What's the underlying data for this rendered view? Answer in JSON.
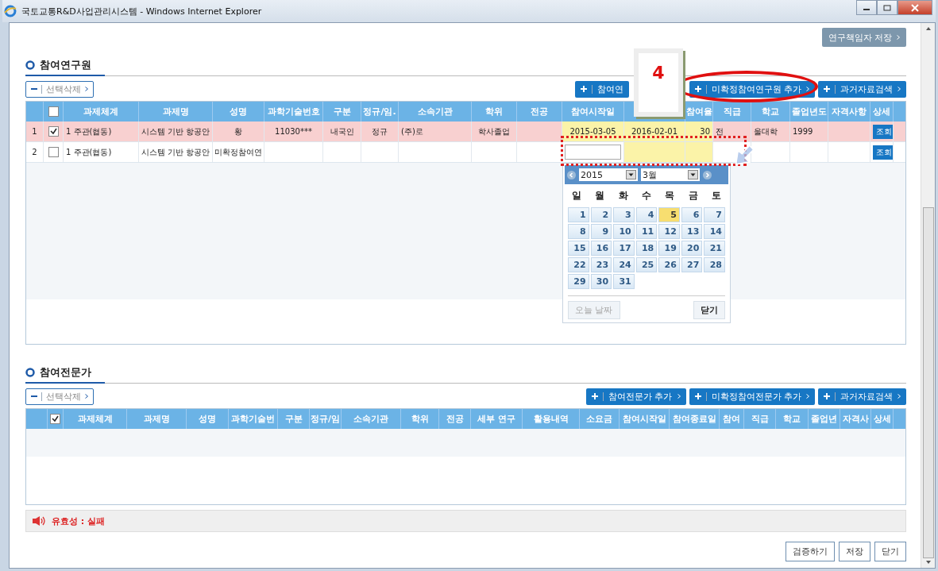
{
  "window": {
    "title": "국토교통R&D사업관리시스템 - Windows Internet Explorer"
  },
  "top_button": "연구책임자 저장",
  "researchers": {
    "title": "참여연구원",
    "delete_button": "선택삭제",
    "buttons": [
      "참여연",
      "미확정참여연구원 추가",
      "과거자료검색"
    ],
    "header_checked": false,
    "columns": [
      {
        "label": "과제체계"
      },
      {
        "label": "과제명"
      },
      {
        "label": "성명"
      },
      {
        "label": "과학기술번호"
      },
      {
        "label": "구분"
      },
      {
        "label": "정규/임."
      },
      {
        "label": "소속기관"
      },
      {
        "label": "학위"
      },
      {
        "label": "전공"
      },
      {
        "label": "참여시작일"
      },
      {},
      {
        "label": "참여율"
      },
      {
        "label": "직급"
      },
      {
        "label": "학교"
      },
      {
        "label": "졸업년도"
      },
      {
        "label": "자격사항"
      },
      {
        "label": "상세"
      }
    ],
    "rows": [
      {
        "number": "1",
        "checked": true,
        "selected": true,
        "cells": [
          {
            "text": "1 주관(협동)"
          },
          {
            "text": "시스템 기반 항공안"
          },
          {
            "text": "황"
          },
          {
            "text": "11030***"
          },
          {
            "text": "내국인"
          },
          {
            "text": "정규"
          },
          {
            "text": "(주)로"
          },
          {
            "text": "학사졸업"
          },
          {},
          {
            "text": "2015-03-05",
            "kind": "date"
          },
          {
            "text": "2016-02-01",
            "kind": "date"
          },
          {
            "text": "30",
            "kind": "date"
          },
          {
            "text": "전"
          },
          {
            "text": "울대학"
          },
          {
            "text": "1999"
          },
          {},
          {
            "text": "조회",
            "kind": "button"
          }
        ]
      },
      {
        "number": "2",
        "checked": false,
        "selected": false,
        "cells": [
          {
            "text": "1 주관(협동)"
          },
          {
            "text": "시스템 기반 항공안"
          },
          {
            "text": "미확정참여연"
          },
          {},
          {},
          {},
          {},
          {},
          {},
          {
            "kind": "input"
          },
          {
            "kind": "date"
          },
          {
            "kind": "date"
          },
          {},
          {},
          {},
          {},
          {
            "text": "조회",
            "kind": "button"
          }
        ]
      }
    ]
  },
  "calendar": {
    "year": "2015",
    "month": "3월",
    "weekdays": [
      "일",
      "월",
      "화",
      "수",
      "목",
      "금",
      "토"
    ],
    "days": [
      {
        "text": "1",
        "selected": false
      },
      {
        "text": "2",
        "selected": false
      },
      {
        "text": "3",
        "selected": false
      },
      {
        "text": "4",
        "selected": false
      },
      {
        "text": "5",
        "selected": true
      },
      {
        "text": "6",
        "selected": false
      },
      {
        "text": "7",
        "selected": false
      },
      {
        "text": "8",
        "selected": false
      },
      {
        "text": "9",
        "selected": false
      },
      {
        "text": "10",
        "selected": false
      },
      {
        "text": "11",
        "selected": false
      },
      {
        "text": "12",
        "selected": false
      },
      {
        "text": "13",
        "selected": false
      },
      {
        "text": "14",
        "selected": false
      },
      {
        "text": "15",
        "selected": false
      },
      {
        "text": "16",
        "selected": false
      },
      {
        "text": "17",
        "selected": false
      },
      {
        "text": "18",
        "selected": false
      },
      {
        "text": "19",
        "selected": false
      },
      {
        "text": "20",
        "selected": false
      },
      {
        "text": "21",
        "selected": false
      },
      {
        "text": "22",
        "selected": false
      },
      {
        "text": "23",
        "selected": false
      },
      {
        "text": "24",
        "selected": false
      },
      {
        "text": "25",
        "selected": false
      },
      {
        "text": "26",
        "selected": false
      },
      {
        "text": "27",
        "selected": false
      },
      {
        "text": "28",
        "selected": false
      },
      {
        "text": "29",
        "selected": false
      },
      {
        "text": "30",
        "selected": false
      },
      {
        "text": "31",
        "selected": false
      }
    ],
    "today_button": {
      "label": "오늘 날짜",
      "disabled": true
    },
    "close_button": "닫기"
  },
  "callout": "4",
  "experts": {
    "title": "참여전문가",
    "delete_button": "선택삭제",
    "buttons": [
      "참여전문가 추가",
      "미확정참여전문가 추가",
      "과거자료검색"
    ],
    "header_checked": true,
    "columns": [
      {
        "label": "과제체계"
      },
      {
        "label": "과제명"
      },
      {
        "label": "성명"
      },
      {
        "label": "과학기술번"
      },
      {
        "label": "구분"
      },
      {
        "label": "정규/임"
      },
      {
        "label": "소속기관"
      },
      {
        "label": "학위"
      },
      {
        "label": "전공"
      },
      {
        "label": "세부 연구"
      },
      {
        "label": "활용내역"
      },
      {
        "label": "소요금"
      },
      {
        "label": "참여시작일"
      },
      {
        "label": "참여종료일"
      },
      {
        "label": "참여"
      },
      {
        "label": "직급"
      },
      {
        "label": "학교"
      },
      {
        "label": "졸업년"
      },
      {
        "label": "자격사"
      },
      {
        "label": "상세"
      }
    ]
  },
  "status": {
    "label": "유효성 : 실패"
  },
  "footer_buttons": [
    "검증하기",
    "저장",
    "닫기"
  ]
}
